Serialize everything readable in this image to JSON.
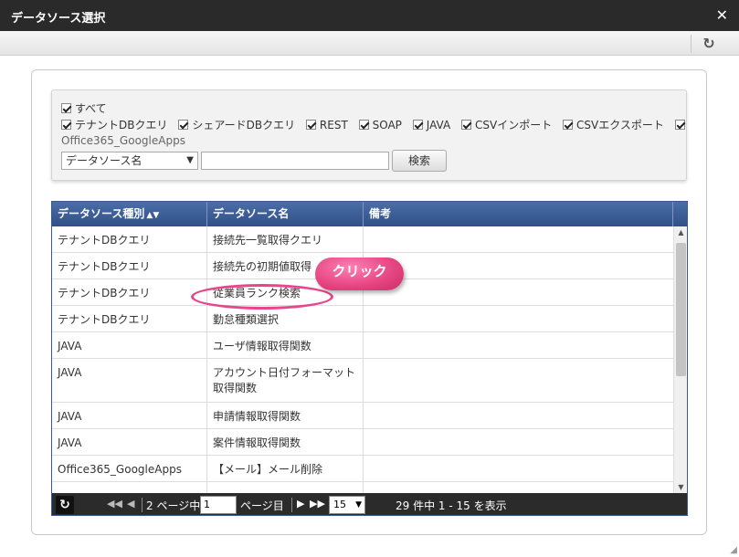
{
  "window": {
    "title": "データソース選択",
    "close_icon": "close-icon",
    "refresh_icon": "refresh-icon"
  },
  "filters": {
    "all_label": "すべて",
    "types": [
      "テナントDBクエリ",
      "シェアードDBクエリ",
      "REST",
      "SOAP",
      "JAVA",
      "CSVインポート",
      "CSVエクスポート"
    ],
    "last_type": "Office365_GoogleApps",
    "search_field": "データソース名",
    "search_value": "",
    "search_button": "検索"
  },
  "table": {
    "headers": [
      "データソース種別",
      "データソース名",
      "備考"
    ],
    "rows": [
      [
        "テナントDBクエリ",
        "接続先一覧取得クエリ",
        ""
      ],
      [
        "テナントDBクエリ",
        "接続先の初期値取得",
        ""
      ],
      [
        "テナントDBクエリ",
        "従業員ランク検索",
        ""
      ],
      [
        "テナントDBクエリ",
        "勤怠種類選択",
        ""
      ],
      [
        "JAVA",
        "ユーザ情報取得関数",
        ""
      ],
      [
        "JAVA",
        "アカウント日付フォーマット取得関数",
        ""
      ],
      [
        "JAVA",
        "申請情報取得関数",
        ""
      ],
      [
        "JAVA",
        "案件情報取得関数",
        ""
      ],
      [
        "Office365_GoogleApps",
        "【メール】メール削除",
        ""
      ]
    ]
  },
  "pager": {
    "page_prefix": "2 ページ中",
    "page_value": "1",
    "page_suffix": "ページ目",
    "page_size": "15",
    "summary": "29 件中 1 - 15 を表示"
  },
  "annotation": {
    "label": "クリック",
    "color": "#e8458c"
  }
}
